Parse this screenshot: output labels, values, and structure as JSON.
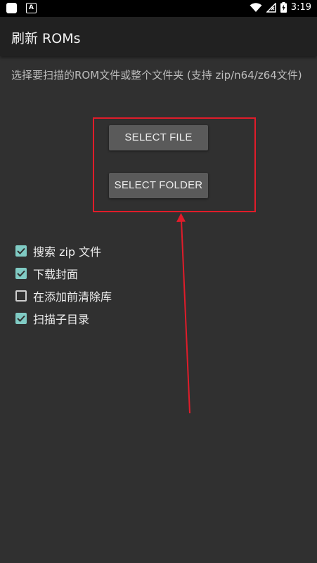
{
  "status_bar": {
    "time": "3:19",
    "icons": [
      "app-notification-icon",
      "a-notification-icon",
      "wifi-icon",
      "no-signal-icon",
      "battery-charging-icon"
    ]
  },
  "app_bar": {
    "title": "刷新 ROMs"
  },
  "main": {
    "instruction": "选择要扫描的ROM文件或整个文件夹 (支持 zip/n64/z64文件)",
    "select_file_label": "SELECT FILE",
    "select_folder_label": "SELECT FOLDER",
    "options": [
      {
        "label": "搜索 zip 文件",
        "checked": true
      },
      {
        "label": "下载封面",
        "checked": true
      },
      {
        "label": "在添加前清除库",
        "checked": false
      },
      {
        "label": "扫描子目录",
        "checked": true
      }
    ]
  },
  "annotation": {
    "highlight_color": "#e01c2a"
  },
  "theme": {
    "accent_checkbox": "#80cbc4",
    "background": "#303030",
    "app_bar": "#212121"
  }
}
